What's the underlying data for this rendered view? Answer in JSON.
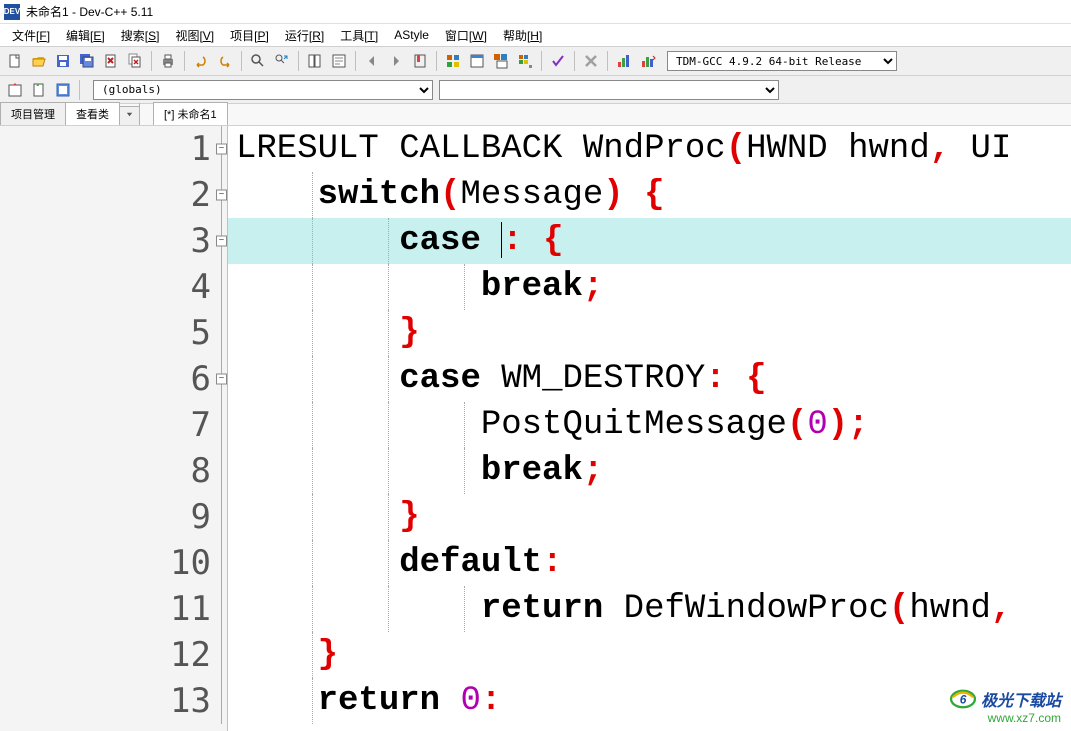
{
  "window": {
    "icon_label": "DEV",
    "title": "未命名1 - Dev-C++ 5.11"
  },
  "menus": [
    {
      "label": "文件",
      "key": "F"
    },
    {
      "label": "编辑",
      "key": "E"
    },
    {
      "label": "搜索",
      "key": "S"
    },
    {
      "label": "视图",
      "key": "V"
    },
    {
      "label": "项目",
      "key": "P"
    },
    {
      "label": "运行",
      "key": "R"
    },
    {
      "label": "工具",
      "key": "T"
    },
    {
      "label": "AStyle",
      "key": ""
    },
    {
      "label": "窗口",
      "key": "W"
    },
    {
      "label": "帮助",
      "key": "H"
    }
  ],
  "toolbar": {
    "compiler": "TDM-GCC 4.9.2 64-bit Release"
  },
  "toolbar2": {
    "globals": "(globals)"
  },
  "sidetabs": {
    "project": "项目管理",
    "view": "查看类"
  },
  "filetab": "[*] 未命名1",
  "code": {
    "lines": [
      {
        "n": 1,
        "fold": "-",
        "tokens": [
          [
            "txt",
            "LRESULT CALLBACK WndProc"
          ],
          [
            "punct",
            "("
          ],
          [
            "txt",
            "HWND hwnd"
          ],
          [
            "punct",
            ","
          ],
          [
            "txt",
            " UI"
          ]
        ]
      },
      {
        "n": 2,
        "fold": "-",
        "indent": 1,
        "tokens": [
          [
            "kw",
            "switch"
          ],
          [
            "punct",
            "("
          ],
          [
            "txt",
            "Message"
          ],
          [
            "punct",
            ")"
          ],
          [
            "txt",
            " "
          ],
          [
            "punct",
            "{"
          ]
        ]
      },
      {
        "n": 3,
        "fold": "-",
        "indent": 2,
        "hl": true,
        "tokens": [
          [
            "kw",
            "case "
          ],
          [
            "txt",
            "|"
          ],
          [
            "punct",
            ":"
          ],
          [
            "txt",
            " "
          ],
          [
            "punct",
            "{"
          ]
        ]
      },
      {
        "n": 4,
        "indent": 3,
        "tokens": [
          [
            "kw",
            "break"
          ],
          [
            "punct",
            ";"
          ]
        ]
      },
      {
        "n": 5,
        "indent": 2,
        "tokens": [
          [
            "punct",
            "}"
          ]
        ]
      },
      {
        "n": 6,
        "fold": "-",
        "indent": 2,
        "tokens": [
          [
            "kw",
            "case"
          ],
          [
            "txt",
            " WM_DESTROY"
          ],
          [
            "punct",
            ":"
          ],
          [
            "txt",
            " "
          ],
          [
            "punct",
            "{"
          ]
        ]
      },
      {
        "n": 7,
        "indent": 3,
        "tokens": [
          [
            "txt",
            "PostQuitMessage"
          ],
          [
            "punct",
            "("
          ],
          [
            "num",
            "0"
          ],
          [
            "punct",
            ");"
          ]
        ]
      },
      {
        "n": 8,
        "indent": 3,
        "tokens": [
          [
            "kw",
            "break"
          ],
          [
            "punct",
            ";"
          ]
        ]
      },
      {
        "n": 9,
        "indent": 2,
        "tokens": [
          [
            "punct",
            "}"
          ]
        ]
      },
      {
        "n": 10,
        "indent": 2,
        "tokens": [
          [
            "kw",
            "default"
          ],
          [
            "punct",
            ":"
          ]
        ]
      },
      {
        "n": 11,
        "indent": 3,
        "tokens": [
          [
            "kw",
            "return"
          ],
          [
            "txt",
            " DefWindowProc"
          ],
          [
            "punct",
            "("
          ],
          [
            "txt",
            "hwnd"
          ],
          [
            "punct",
            ","
          ]
        ]
      },
      {
        "n": 12,
        "indent": 1,
        "tokens": [
          [
            "punct",
            "}"
          ]
        ]
      },
      {
        "n": 13,
        "indent": 1,
        "tokens": [
          [
            "kw",
            "return"
          ],
          [
            "txt",
            " "
          ],
          [
            "num",
            "0"
          ],
          [
            "punct",
            ":"
          ]
        ]
      }
    ]
  },
  "watermark": {
    "brand": "极光下载站",
    "url": "www.xz7.com"
  },
  "icons": {
    "new": "new-file-icon",
    "open": "open-icon",
    "save": "save-icon",
    "saveall": "save-all-icon",
    "close": "close-icon",
    "closeall": "close-all-icon",
    "print": "print-icon",
    "undo": "undo-icon",
    "redo": "redo-icon",
    "find": "find-icon",
    "replace": "replace-icon",
    "findfiles": "find-files-icon",
    "goto": "goto-icon",
    "back": "back-icon",
    "fwd": "forward-icon",
    "bookmark": "bookmark-icon",
    "compile": "compile-icon",
    "run": "run-icon",
    "compilerun": "compile-run-icon",
    "rebuild": "rebuild-icon",
    "syntax": "syntax-icon",
    "stop": "stop-icon",
    "profile": "profile-icon",
    "debug": "debug-icon",
    "newproj": "new-project-icon",
    "addfile": "add-file-icon",
    "options": "options-icon"
  }
}
